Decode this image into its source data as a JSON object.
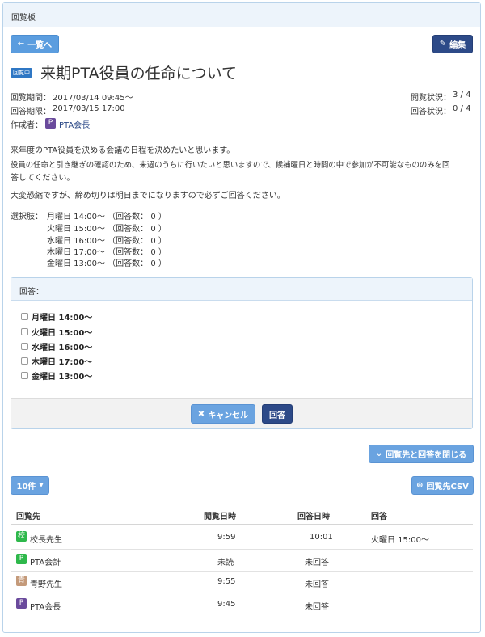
{
  "panel": {
    "title": "回覧板"
  },
  "toolbar": {
    "back_label": "一覧へ",
    "edit_label": "編集"
  },
  "item": {
    "status_badge": "回覧中",
    "title": "来期PTA役員の任命について",
    "period_label": "回覧期間：",
    "period_value": "2017/03/14 09:45〜",
    "deadline_label": "回答期限：",
    "deadline_value": "2017/03/15 17:00",
    "author_label": "作成者：",
    "author_initial": "P",
    "author_name": "PTA会長",
    "view_status_label": "閲覧状況：",
    "view_status_value": "3 / 4",
    "answer_status_label": "回答状況：",
    "answer_status_value": "0 / 4",
    "body_1": "来年度のPTA役員を決める会議の日程を決めたいと思います。",
    "body_2a": "役員の任命と引き継ぎの確認のため、来週のうちに行いたいと思いますので、候補曜日と時間の中で参加が不可能なもののみを回",
    "body_2b": "答してください。",
    "body_3": "大変恐縮ですが、締め切りは明日までになりますので必ずご回答ください。",
    "choices_label": "選択肢：",
    "choices": [
      "月曜日 14:00〜 （回答数： 0 ）",
      "火曜日 15:00〜 （回答数： 0 ）",
      "水曜日 16:00〜 （回答数： 0 ）",
      "木曜日 17:00〜 （回答数： 0 ）",
      "金曜日 13:00〜 （回答数： 0 ）"
    ]
  },
  "answer_form": {
    "header": "回答：",
    "options": [
      "月曜日 14:00〜",
      "火曜日 15:00〜",
      "水曜日 16:00〜",
      "木曜日 17:00〜",
      "金曜日 13:00〜"
    ],
    "cancel_label": "キャンセル",
    "submit_label": "回答"
  },
  "recipients": {
    "close_label": "回覧先と回答を閉じる",
    "page_size_label": "10件",
    "csv_label": "回覧先CSV",
    "columns": [
      "回覧先",
      "閲覧日時",
      "回答日時",
      "回答"
    ],
    "rows": [
      {
        "initial": "校",
        "color": "#2eb84b",
        "name": "校長先生",
        "viewed": "9:59",
        "answered": "10:01",
        "answer": "火曜日 15:00〜"
      },
      {
        "initial": "P",
        "color": "#2eb84b",
        "name": "PTA会計",
        "viewed": "未読",
        "answered": "未回答",
        "answer": ""
      },
      {
        "initial": "青",
        "color": "#c49a7a",
        "name": "青野先生",
        "viewed": "9:55",
        "answered": "未回答",
        "answer": ""
      },
      {
        "initial": "P",
        "color": "#6a4a9c",
        "name": "PTA会長",
        "viewed": "9:45",
        "answered": "未回答",
        "answer": ""
      }
    ]
  },
  "colors": {
    "primary": "#5b9ddf",
    "navy": "#2d4a88",
    "author_avatar": "#6a4a9c"
  }
}
